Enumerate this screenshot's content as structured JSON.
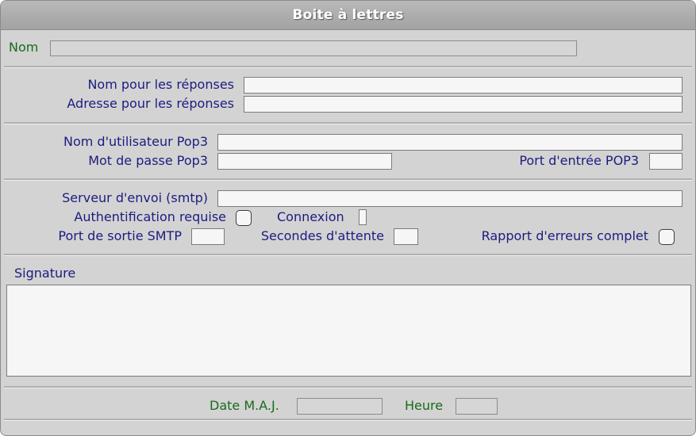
{
  "window": {
    "title": "Boite à lettres"
  },
  "fields": {
    "nom": {
      "label": "Nom",
      "value": ""
    },
    "nom_reponses": {
      "label": "Nom pour les réponses",
      "value": ""
    },
    "adresse_reponses": {
      "label": "Adresse pour les réponses",
      "value": ""
    },
    "utilisateur_pop3": {
      "label": "Nom d'utilisateur Pop3",
      "value": ""
    },
    "mot_de_passe_pop3": {
      "label": "Mot de passe Pop3",
      "value": ""
    },
    "port_entree_pop3": {
      "label": "Port d'entrée POP3",
      "value": ""
    },
    "serveur_envoi": {
      "label": "Serveur d'envoi (smtp)",
      "value": ""
    },
    "authentification": {
      "label": "Authentification requise",
      "checked": false
    },
    "connexion": {
      "label": "Connexion",
      "value": ""
    },
    "port_sortie_smtp": {
      "label": "Port de sortie SMTP",
      "value": ""
    },
    "secondes_attente": {
      "label": "Secondes d'attente",
      "value": ""
    },
    "rapport_erreurs": {
      "label": "Rapport d'erreurs complet",
      "checked": false
    },
    "signature": {
      "label": "Signature",
      "value": ""
    },
    "date_maj": {
      "label": "Date M.A.J.",
      "value": ""
    },
    "heure": {
      "label": "Heure",
      "value": ""
    }
  }
}
